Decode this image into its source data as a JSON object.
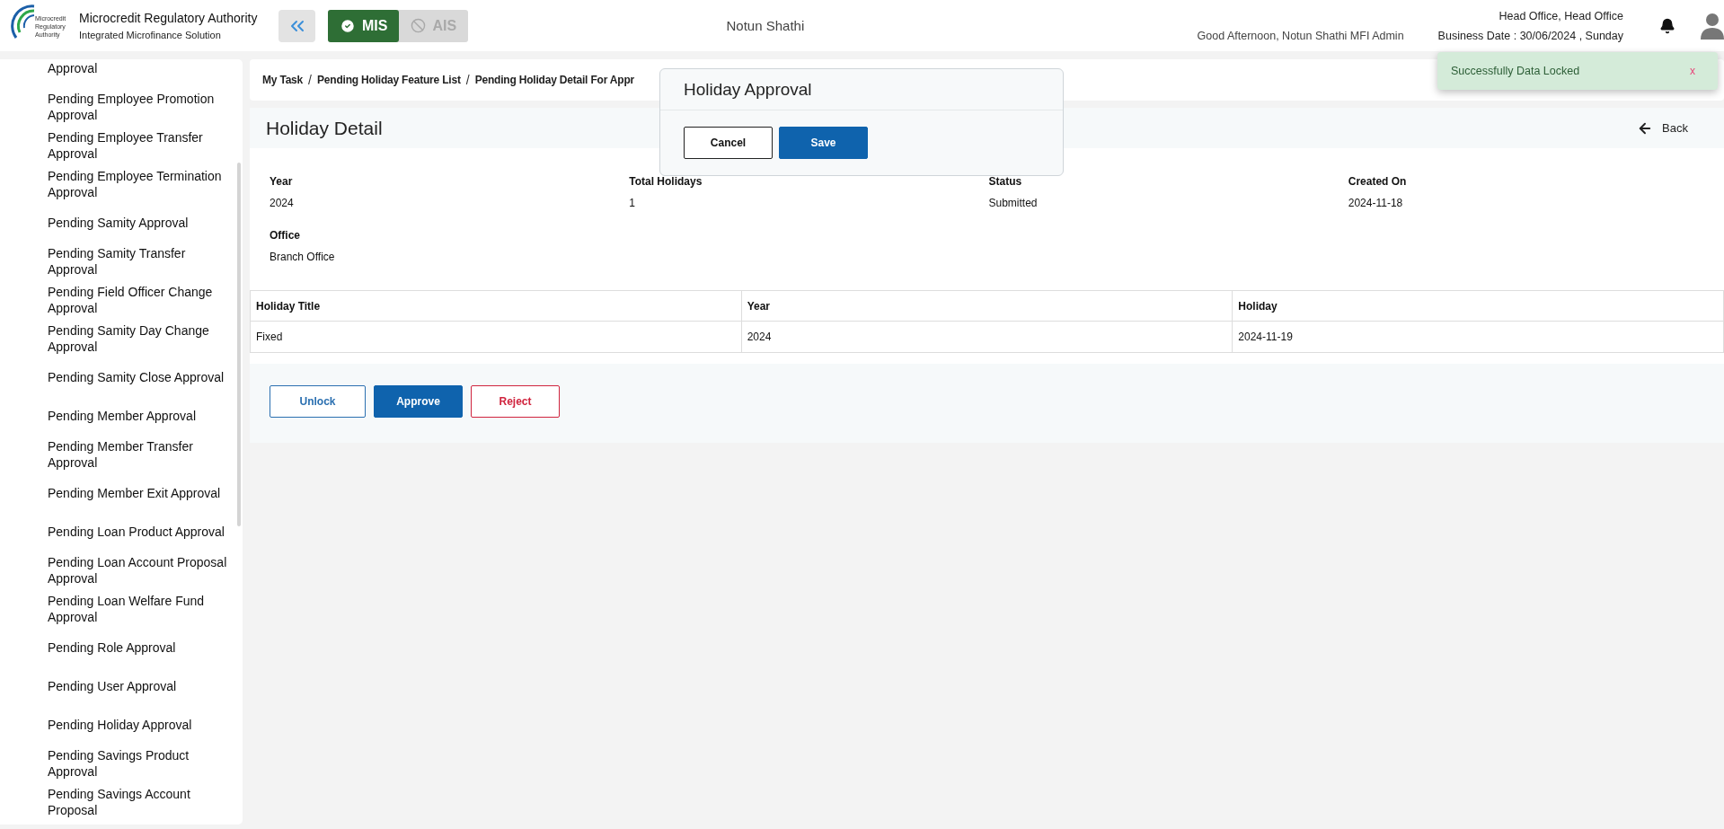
{
  "header": {
    "logo_text": [
      "Microcredit",
      "Regulatory",
      "Authority"
    ],
    "org_title": "Microcredit Regulatory Authority",
    "org_subtitle": "Integrated Microfinance Solution",
    "modules": [
      {
        "label": "MIS",
        "selected": true
      },
      {
        "label": "AIS",
        "selected": false
      }
    ],
    "company": "Notun Shathi",
    "greeting": "Good Afternoon, Notun Shathi MFI Admin",
    "office": "Head Office, Head Office",
    "business_date": "Business Date : 30/06/2024 , Sunday"
  },
  "sidebar": {
    "items": [
      "Approval",
      "Pending Employee Promotion Approval",
      "Pending Employee Transfer Approval",
      "Pending Employee Termination Approval",
      "Pending Samity Approval",
      "Pending Samity Transfer Approval",
      "Pending Field Officer Change Approval",
      "Pending Samity Day Change Approval",
      "Pending Samity Close Approval",
      "Pending Member Approval",
      "Pending Member Transfer Approval",
      "Pending Member Exit Approval",
      "Pending Loan Product Approval",
      "Pending Loan Account Proposal Approval",
      "Pending Loan Welfare Fund Approval",
      "Pending Role Approval",
      "Pending User Approval",
      "Pending Holiday Approval",
      "Pending Savings Product Approval",
      "Pending Savings Account Proposal"
    ]
  },
  "breadcrumb": {
    "separator": "/",
    "items": [
      "My Task",
      "Pending Holiday Feature List",
      "Pending Holiday Detail For Appr"
    ]
  },
  "detail": {
    "title": "Holiday Detail",
    "back_label": "Back",
    "fields": [
      {
        "label": "Year",
        "value": "2024"
      },
      {
        "label": "Total Holidays",
        "value": "1"
      },
      {
        "label": "Status",
        "value": "Submitted"
      },
      {
        "label": "Created On",
        "value": "2024-11-18"
      },
      {
        "label": "Office",
        "value": "Branch Office"
      }
    ],
    "table": {
      "columns": [
        "Holiday Title",
        "Year",
        "Holiday"
      ],
      "rows": [
        [
          "Fixed",
          "2024",
          "2024-11-19"
        ]
      ]
    },
    "actions": [
      {
        "label": "Unlock",
        "kind": "outline"
      },
      {
        "label": "Approve",
        "kind": "primary"
      },
      {
        "label": "Reject",
        "kind": "danger"
      }
    ]
  },
  "modal": {
    "title": "Holiday Approval",
    "buttons": [
      {
        "label": "Cancel",
        "kind": "plain"
      },
      {
        "label": "Save",
        "kind": "primary"
      }
    ]
  },
  "toast": {
    "message": "Successfully Data Locked",
    "close": "x"
  }
}
